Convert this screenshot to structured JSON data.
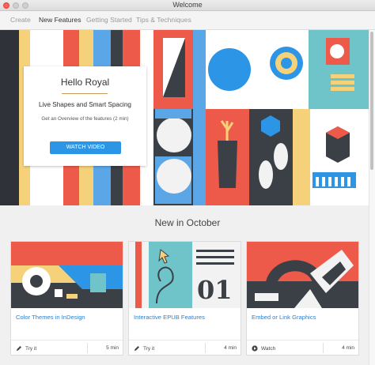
{
  "window": {
    "title": "Welcome"
  },
  "tabs": [
    {
      "label": "Create",
      "active": false
    },
    {
      "label": "New Features",
      "active": true
    },
    {
      "label": "Getting Started",
      "active": false
    },
    {
      "label": "Tips & Techniques",
      "active": false
    }
  ],
  "hero": {
    "title": "Hello Royal",
    "subtitle": "Live Shapes and Smart Spacing",
    "description": "Get an Overview of the features (2 min)",
    "button_label": "WATCH VIDEO"
  },
  "section": {
    "title": "New in October"
  },
  "cards": [
    {
      "title": "Color Themes in InDesign",
      "action": "Try it",
      "action_icon": "pencil-icon",
      "duration": "5 min"
    },
    {
      "title": "Interactive EPUB Features",
      "action": "Try it",
      "action_icon": "pencil-icon",
      "duration": "4 min"
    },
    {
      "title": "Embed or Link Graphics",
      "action": "Watch",
      "action_icon": "play-icon",
      "duration": "4 min"
    }
  ],
  "colors": {
    "accent": "#2d95e6",
    "link": "#2d7fd0",
    "hero_dark": "#3b3f46",
    "coral": "#ee5a4a",
    "yellow": "#f5d27a",
    "sky": "#5ba6e6",
    "teal": "#6fc4c9"
  }
}
